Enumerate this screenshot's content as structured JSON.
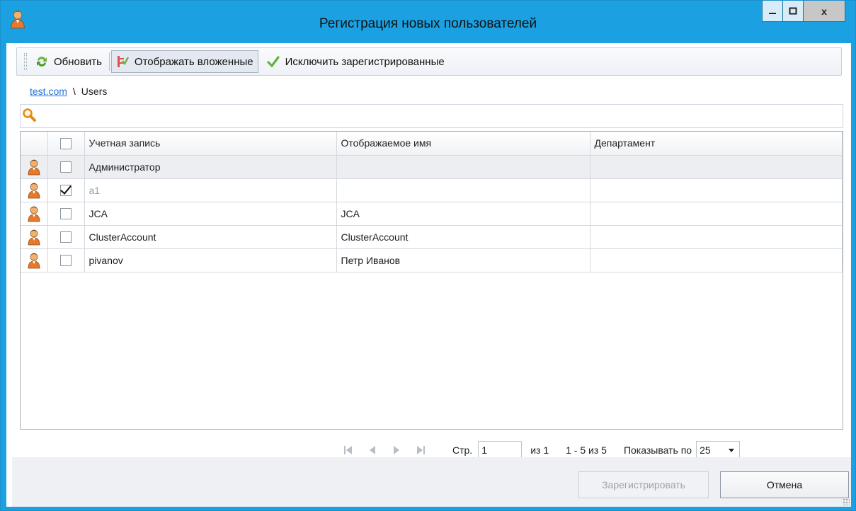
{
  "window": {
    "title": "Регистрация новых пользователей",
    "close_glyph": "x",
    "accent_color": "#1ba1e2",
    "icon": "user-icon"
  },
  "toolbar": {
    "refresh_label": "Обновить",
    "show_nested_label": "Отображать вложенные",
    "exclude_registered_label": "Исключить зарегистрированные"
  },
  "breadcrumb": {
    "domain": "test.com",
    "separator": "\\",
    "container": "Users"
  },
  "search": {
    "value": "",
    "icon": "search-icon"
  },
  "table": {
    "columns": [
      "Учетная запись",
      "Отображаемое имя",
      "Департамент"
    ],
    "rows": [
      {
        "account": "Администратор",
        "display_name": "",
        "department": "",
        "checked": false,
        "selected": true,
        "dimmed": false
      },
      {
        "account": "a1",
        "display_name": "",
        "department": "",
        "checked": true,
        "selected": false,
        "dimmed": true
      },
      {
        "account": "JCA",
        "display_name": "JCA",
        "department": "",
        "checked": false,
        "selected": false,
        "dimmed": false
      },
      {
        "account": "ClusterAccount",
        "display_name": "ClusterAccount",
        "department": "",
        "checked": false,
        "selected": false,
        "dimmed": false
      },
      {
        "account": "pivanov",
        "display_name": "Петр Иванов",
        "department": "",
        "checked": false,
        "selected": false,
        "dimmed": false
      }
    ]
  },
  "pager": {
    "page_label": "Стр.",
    "page_value": "1",
    "of_label": "из 1",
    "range_label": "1 - 5 из 5",
    "page_size_label": "Показывать по",
    "page_size_value": "25"
  },
  "footer": {
    "register_label": "Зарегистрировать",
    "cancel_label": "Отмена"
  }
}
